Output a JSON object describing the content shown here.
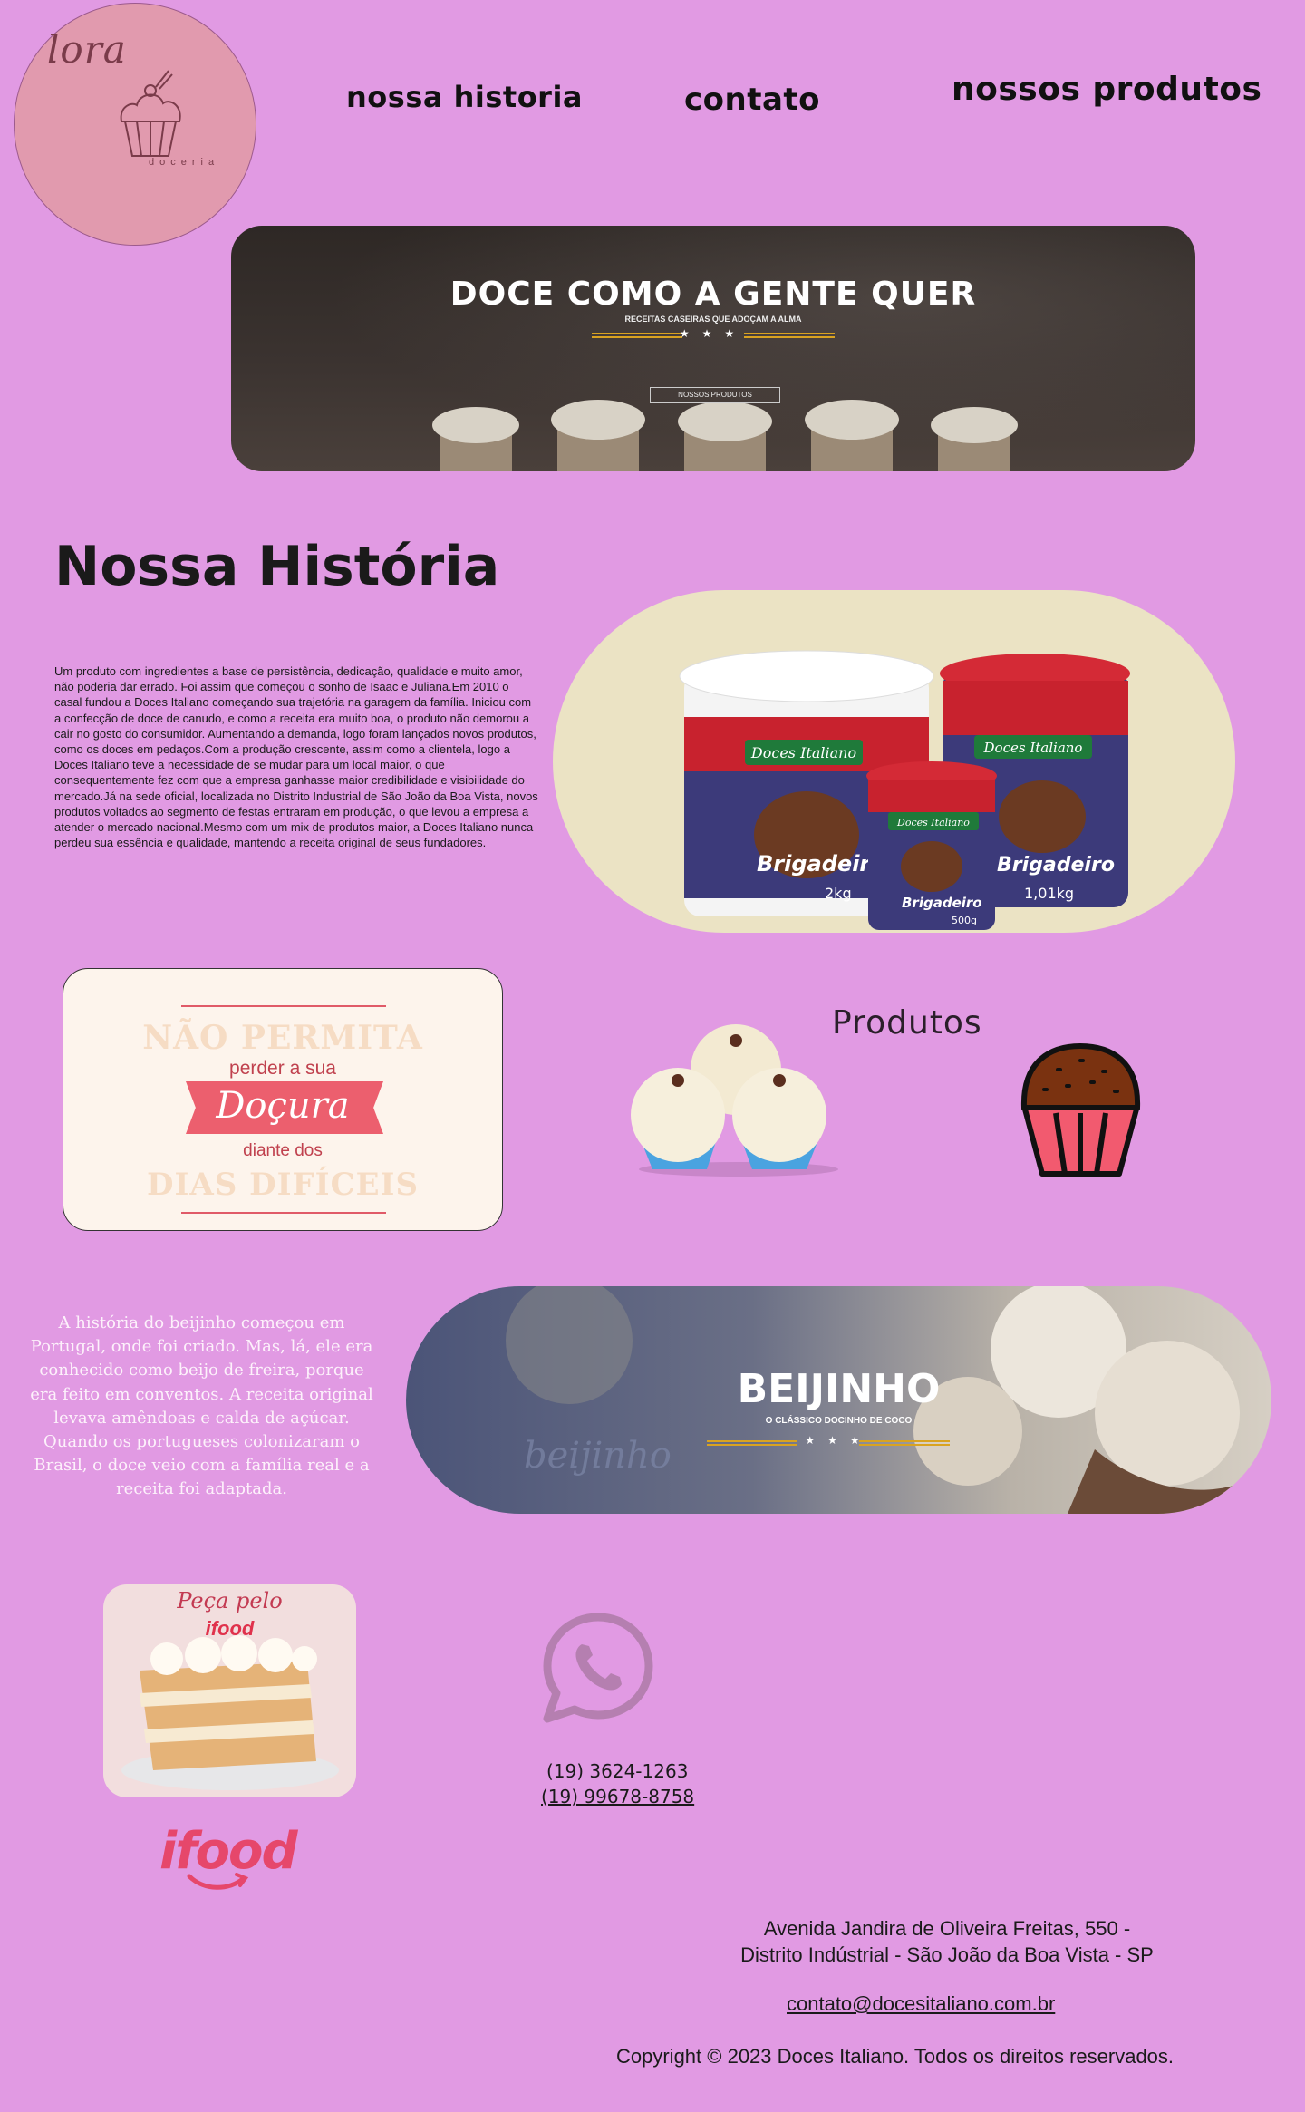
{
  "logo": {
    "script": "lora",
    "sub": "doceria"
  },
  "nav": {
    "historia": "nossa historia",
    "contato": "contato",
    "produtos": "nossos produtos"
  },
  "hero": {
    "title": "DOCE COMO A GENTE QUER",
    "subtitle": "RECEITAS CASEIRAS QUE ADOÇAM A ALMA",
    "stars": "★★★",
    "button": "NOSSOS PRODUTOS"
  },
  "historia": {
    "title": "Nossa História",
    "text": "Um produto com ingredientes a base de persistência, dedicação, qualidade e muito amor, não poderia dar errado. Foi assim que começou o sonho de Isaac e Juliana.Em 2010 o casal fundou a Doces Italiano começando sua trajetória na garagem da família. Iniciou com a confecção de doce de canudo, e como a receita era muito boa, o produto não demorou a cair no gosto do consumidor. Aumentando a demanda, logo foram lançados novos produtos, como os doces em pedaços.Com a produção crescente, assim como a clientela, logo a Doces Italiano teve a necessidade de se mudar para um local maior, o que consequentemente fez com que a empresa ganhasse maior credibilidade e visibilidade do mercado.Já na sede oficial, localizada no Distrito Industrial de São João da Boa Vista, novos produtos voltados ao segmento de festas entraram em produção, o que levou a empresa a atender o mercado nacional.Mesmo com um mix de produtos maior, a Doces Italiano nunca perdeu sua essência e qualidade, mantendo a receita original de seus fundadores."
  },
  "buckets": {
    "brand": "Doces Italiano",
    "product": "Brigadeiro",
    "sizes": [
      "2kg",
      "1,01kg",
      "500g"
    ]
  },
  "docura": {
    "l1": "NÃO PERMITA",
    "l2": "perder a sua",
    "l3": "Doçura",
    "l4": "diante dos",
    "l5": "DIAS DIFÍCEIS"
  },
  "produtos": {
    "title": "Produtos"
  },
  "beijinho": {
    "text": "A história do beijinho começou em Portugal, onde foi criado. Mas, lá, ele era conhecido como beijo de freira, porque era feito em conventos. A receita original levava amêndoas e calda de açúcar. Quando os portugueses colonizaram o Brasil, o doce veio com a família real e a receita foi adaptada.",
    "title": "BEIJINHO",
    "subtitle": "O CLÁSSICO DOCINHO DE COCO",
    "stars": "★★★",
    "watermark": "beijinho"
  },
  "ifood": {
    "card_t1": "Peça pelo",
    "card_t2": "ifood",
    "logo": "ifood"
  },
  "contact": {
    "phone1": "(19) 3624-1263",
    "phone2": "(19) 99678-8758"
  },
  "footer": {
    "addr1": "Avenida Jandira de Oliveira Freitas, 550 -",
    "addr2": "Distrito Indústrial - São João da Boa Vista - SP",
    "email": "contato@docesitaliano.com.br",
    "copyright": "Copyright © 2023 Doces Italiano. Todos os direitos reservados."
  },
  "colors": {
    "page_bg": "#e19ae3",
    "accent_gold": "#d9a321",
    "ifood_red": "#e6476b",
    "whatsapp_icon": "#b57fb0"
  }
}
